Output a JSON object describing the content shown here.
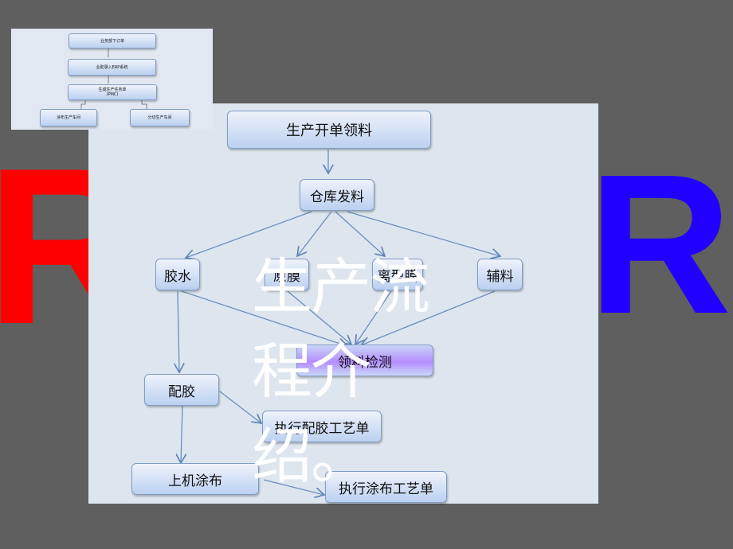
{
  "background_letters": {
    "left": "R",
    "right": "R",
    "left_color": "#ff0000",
    "right_color": "#2200ff"
  },
  "mini": {
    "b1": "业务部下订单",
    "b2": "业助录入ERP系统",
    "b3": "生成生产任务单",
    "b3b": "(PMC)",
    "b4": "涂布生产车间",
    "b5": "分切生产车间"
  },
  "flow": {
    "n1": "生产开单领料",
    "n2": "仓库发料",
    "n3": "胶水",
    "n4": "原膜",
    "n5": "离型膜",
    "n6": "辅料",
    "n7": "领料检测",
    "n8": "配胶",
    "n9": "执行配胶工艺单",
    "n10": "上机涂布",
    "n11": "执行涂布工艺单"
  },
  "title": "生产流程介绍。"
}
